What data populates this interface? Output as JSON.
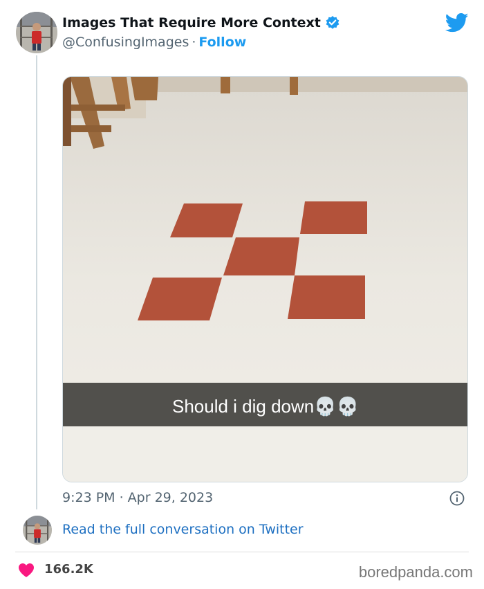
{
  "author": {
    "name": "Images That Require More Context",
    "handle": "@ConfusingImages",
    "separator": "·",
    "follow_label": "Follow",
    "verified_icon": "verified-badge-icon"
  },
  "brand_icon": "twitter-bird-icon",
  "tweet_media": {
    "caption": "Should i dig down💀💀"
  },
  "meta": {
    "timestamp": "9:23 PM · Apr 29, 2023",
    "info_icon": "info-icon"
  },
  "conversation_link": "Read the full conversation on Twitter",
  "footer": {
    "likes": "166.2K",
    "like_icon": "heart-icon",
    "watermark": "boredpanda.com"
  },
  "colors": {
    "accent": "#1d9bf0",
    "link": "#1d6fc1",
    "heart": "#f91880",
    "secondary_text": "#536471",
    "tile": "#b3523a"
  }
}
